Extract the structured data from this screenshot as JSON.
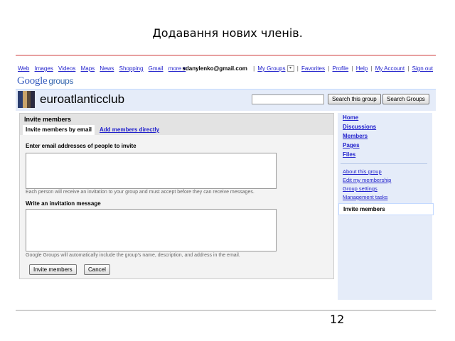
{
  "slide": {
    "title": "Додавання нових членів.",
    "page_number": "12"
  },
  "topnav": {
    "links": [
      "Web",
      "Images",
      "Videos",
      "Maps",
      "News",
      "Shopping",
      "Gmail",
      "more ▾"
    ],
    "email": "sdanylenko@gmail.com",
    "my_groups": "My Groups",
    "dropdown_icon": "▾",
    "right_links": [
      "Favorites",
      "Profile",
      "Help",
      "My Account",
      "Sign out"
    ]
  },
  "logo": {
    "google": "Google",
    "groups": "groups"
  },
  "header": {
    "group_name": "euroatlanticclub",
    "search_value": "",
    "search_this_group": "Search this group",
    "search_groups": "Search Groups"
  },
  "invite": {
    "title": "Invite members",
    "tab_email": "Invite members by email",
    "tab_direct": "Add members directly",
    "email_label": "Enter email addresses of people to invite",
    "email_value": "",
    "email_note": "Each person will receive an invitation to your group and must accept before they can receive messages.",
    "message_label": "Write an invitation message",
    "message_value": "",
    "message_note": "Google Groups will automatically include the group's name, description, and address in the email.",
    "submit": "Invite members",
    "cancel": "Cancel"
  },
  "sidebar": {
    "main_items": [
      "Home",
      "Discussions",
      "Members",
      "Pages",
      "Files"
    ],
    "admin_items": [
      "About this group",
      "Edit my membership",
      "Group settings",
      "Management tasks"
    ],
    "selected": "Invite members"
  },
  "colors": {
    "link": "#2222cc",
    "header_band": "#e5ecf9",
    "panel_bg": "#f3f3f3"
  }
}
